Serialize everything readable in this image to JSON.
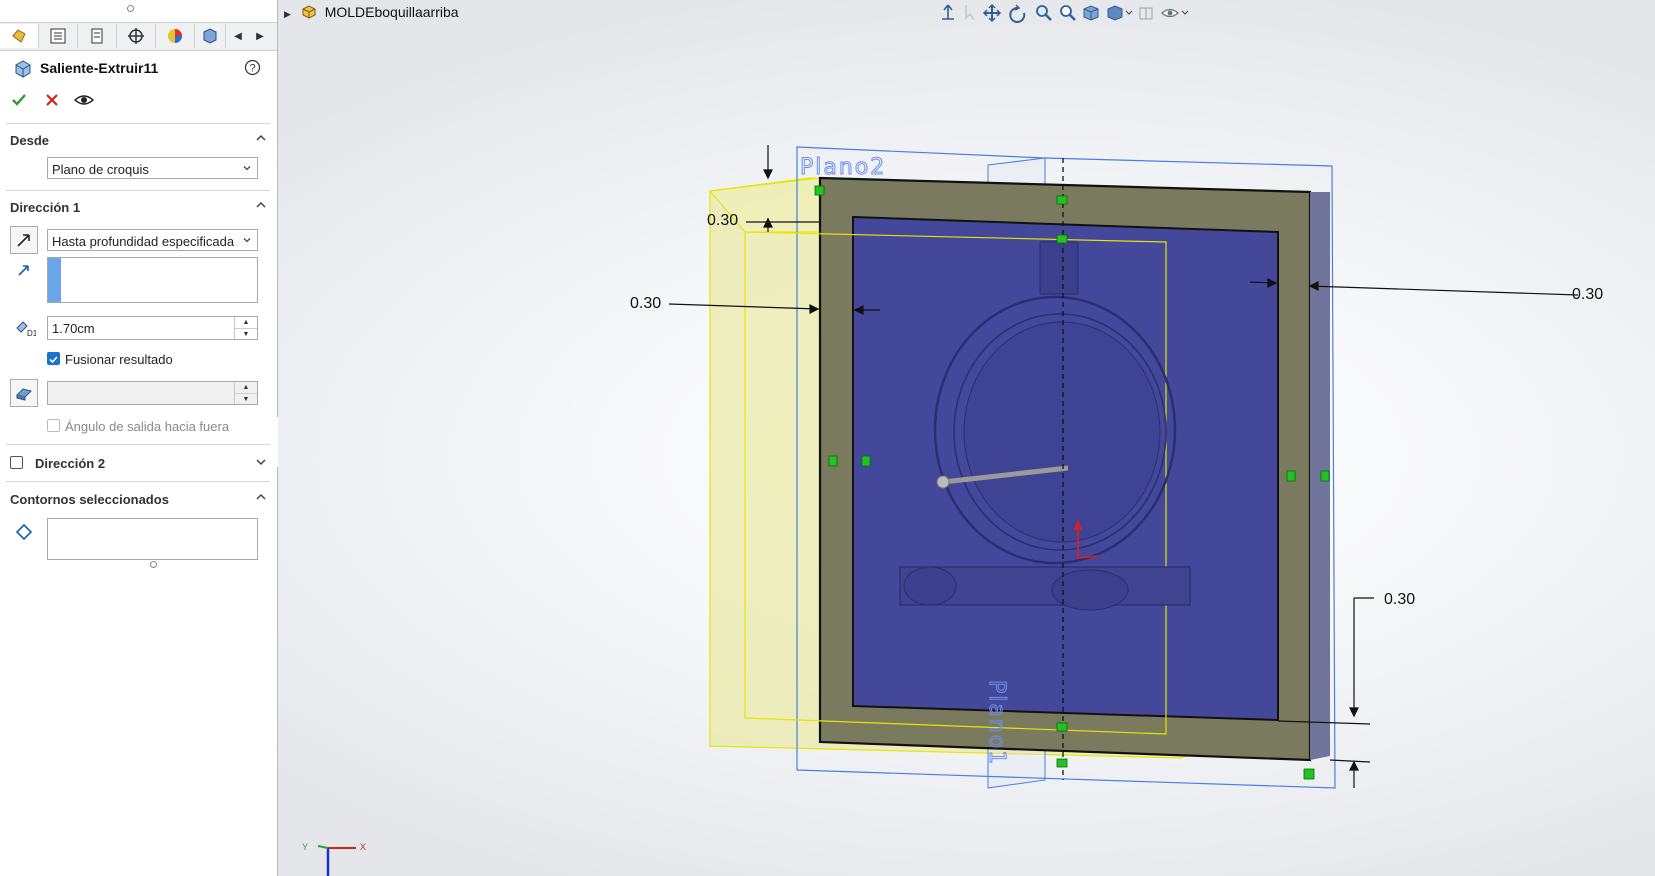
{
  "feature": {
    "title": "Saliente-Extruir11"
  },
  "actions": {
    "ok_icon": "check-icon",
    "cancel_icon": "x-icon",
    "preview_icon": "eye-icon"
  },
  "desde": {
    "title": "Desde",
    "value": "Plano de croquis"
  },
  "direccion1": {
    "title": "Dirección 1",
    "end_condition": "Hasta profundidad especificada",
    "depth": "1.70cm",
    "merge_label": "Fusionar resultado",
    "merge_checked": true,
    "draft_label": "Ángulo de salida hacia fuera"
  },
  "direccion2": {
    "title": "Dirección 2"
  },
  "contornos": {
    "title": "Contornos seleccionados"
  },
  "tree": {
    "part_name": "MOLDEboquillaarriba"
  },
  "viewport": {
    "plane_top": "Plano2",
    "plane_front": "Plano1",
    "dimensions": [
      "0.30",
      "0.30",
      "0.30",
      "0.30"
    ]
  },
  "colors": {
    "accent": "#1a73c8",
    "ok": "#2e9e2e",
    "cancel": "#d62020",
    "plane_blue": "#4a7ee0",
    "face_blue": "#45489a",
    "preview_yellow": "#e8e89a"
  }
}
